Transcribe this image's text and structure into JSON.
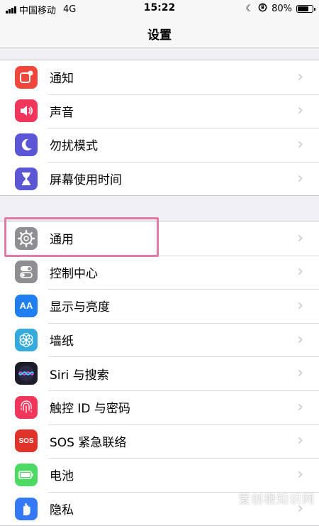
{
  "status_bar": {
    "carrier": "中国移动",
    "network": "4G",
    "time": "15:22",
    "battery": "80%",
    "battery_level": 0.8
  },
  "nav": {
    "title": "设置"
  },
  "group1": [
    {
      "label": "通知",
      "icon": "notification-icon",
      "color": "#f0463c"
    },
    {
      "label": "声音",
      "icon": "speaker-icon",
      "color": "#f2355a"
    },
    {
      "label": "勿扰模式",
      "icon": "moon-icon",
      "color": "#5b56d6"
    },
    {
      "label": "屏幕使用时间",
      "icon": "hourglass-icon",
      "color": "#5b56d6"
    }
  ],
  "group2": [
    {
      "label": "通用",
      "icon": "gear-icon",
      "color": "#8e8e93"
    },
    {
      "label": "控制中心",
      "icon": "toggles-icon",
      "color": "#8e8e93"
    },
    {
      "label": "显示与亮度",
      "icon": "display-aa-icon",
      "color": "#1f7ef0"
    },
    {
      "label": "墙纸",
      "icon": "flower-icon",
      "color": "#35aadc"
    },
    {
      "label": "Siri 与搜索",
      "icon": "siri-icon",
      "color": "#1c1c2a"
    },
    {
      "label": "触控 ID 与密码",
      "icon": "fingerprint-icon",
      "color": "#f2355a"
    },
    {
      "label": "SOS 紧急联络",
      "icon": "sos-icon",
      "color": "#e0342a"
    },
    {
      "label": "电池",
      "icon": "battery-icon",
      "color": "#4cd964"
    },
    {
      "label": "隐私",
      "icon": "hand-icon",
      "color": "#3478f6"
    }
  ],
  "icon_text": {
    "aa": "AA",
    "sos": "SOS"
  },
  "chevron": "›",
  "highlight_color": "#e07ba7",
  "watermark": "爱创根知识网"
}
